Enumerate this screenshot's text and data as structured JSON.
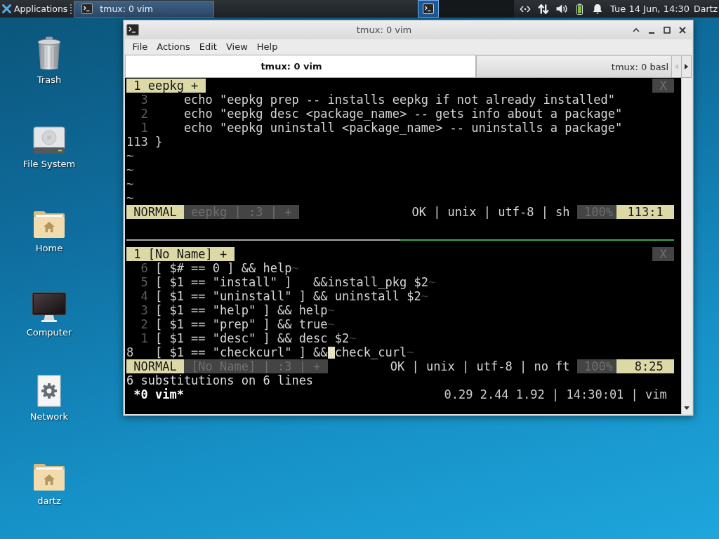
{
  "top_panel": {
    "menu_label": "Applications",
    "tasks": [
      {
        "title": "tmux: 0 vim",
        "selected": true
      }
    ],
    "workspaces": [
      {
        "selected": true,
        "has_window": true
      }
    ],
    "clock": "Tue 14 Jun, 14:30",
    "user": "Dartz"
  },
  "desktop_icons": [
    {
      "label": "Trash",
      "kind": "trash"
    },
    {
      "label": "File System",
      "kind": "drive"
    },
    {
      "label": "Home",
      "kind": "home"
    },
    {
      "label": "Computer",
      "kind": "computer"
    },
    {
      "label": "Network",
      "kind": "network"
    },
    {
      "label": "dartz",
      "kind": "home"
    }
  ],
  "window": {
    "title": "tmux: 0 vim",
    "menu": [
      "File",
      "Actions",
      "Edit",
      "View",
      "Help"
    ],
    "tabs": [
      {
        "label": "tmux: 0 vim",
        "selected": true
      },
      {
        "label": "tmux: 0 basl",
        "selected": false
      }
    ],
    "tab_scroll": [
      {
        "kind": "left",
        "disabled": true
      },
      {
        "kind": "right",
        "disabled": false
      }
    ]
  },
  "terminal": {
    "panes": [
      {
        "active": false,
        "buffer_tabs": [
          {
            "label": "1 eepkg +",
            "selected": true
          }
        ],
        "close_label": "X",
        "lines": [
          {
            "number": "3",
            "current": false,
            "cursor": false,
            "text": "    echo \"eepkg prep -- installs eepkg if not already installed\""
          },
          {
            "number": "2",
            "current": false,
            "cursor": false,
            "text": "    echo \"eepkg desc <package_name> -- gets info about a package\""
          },
          {
            "number": "1",
            "current": false,
            "cursor": false,
            "text": "    echo \"eepkg uninstall <package_name> -- uninstalls a package\""
          },
          {
            "number": "113",
            "current": true,
            "cursor": false,
            "text": "}"
          }
        ],
        "filler": [
          "~",
          "~",
          "~",
          "~"
        ],
        "status": {
          "mode": "NORMAL",
          "file_info": "eepkg | :3 | +",
          "file_format": "OK | unix | utf-8 | sh",
          "percent": "100%",
          "position": "113:1"
        }
      },
      {
        "active": true,
        "buffer_tabs": [
          {
            "label": "1 [No Name] +",
            "selected": true
          }
        ],
        "close_label": "X",
        "lines": [
          {
            "number": "6",
            "current": false,
            "cursor": false,
            "text": "[ $# == 0 ] && help",
            "eol": "~"
          },
          {
            "number": "5",
            "current": false,
            "cursor": false,
            "text": "[ $1 == \"install\" ]   &&install_pkg $2",
            "eol": "~"
          },
          {
            "number": "4",
            "current": false,
            "cursor": false,
            "text": "[ $1 == \"uninstall\" ] && uninstall $2",
            "eol": "~"
          },
          {
            "number": "3",
            "current": false,
            "cursor": false,
            "text": "[ $1 == \"help\" ] && help",
            "eol": "~"
          },
          {
            "number": "2",
            "current": false,
            "cursor": false,
            "text": "[ $1 == \"prep\" ] && true",
            "eol": "~"
          },
          {
            "number": "1",
            "current": false,
            "cursor": false,
            "text": "[ $1 == \"desc\" ] && desc $2",
            "eol": "~"
          },
          {
            "number": "8",
            "current": true,
            "cursor": true,
            "text": "[ $1 == \"checkcurl\" ] && ",
            "text_after_cursor": "check_curl",
            "eol": "~"
          }
        ],
        "status": {
          "mode": "NORMAL",
          "file_info": "[No Name] | :3 | +",
          "file_format": "OK | unix | utf-8 | no ft",
          "percent": "100%",
          "position": "8:25"
        },
        "message": "6 substitutions on 6 lines"
      }
    ],
    "tmux_status": {
      "windows": [
        {
          "label": "*0 vim*",
          "selected": true
        }
      ],
      "info": "0.29 2.44 1.92 | 14:30:01 | vim"
    }
  }
}
